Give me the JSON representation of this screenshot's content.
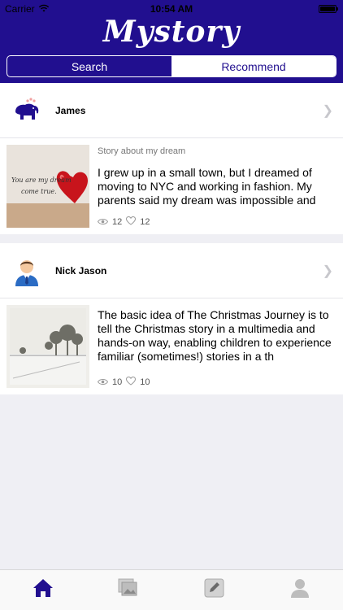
{
  "status_bar": {
    "carrier": "Carrier",
    "time": "10:54 AM"
  },
  "header": {
    "logo": "Mystory",
    "segments": [
      {
        "label": "Search",
        "selected": false
      },
      {
        "label": "Recommend",
        "selected": true
      }
    ]
  },
  "feed": [
    {
      "user": {
        "name": "James",
        "avatar": "elephant-icon"
      },
      "story": {
        "title": "Story about my dream",
        "text": "I grew up in a small town, but I dreamed of moving to NYC and working in fashion. My parents said my dream was impossible and",
        "views": "12",
        "likes": "12",
        "thumb_caption_1": "You are my dream",
        "thumb_caption_2": "come true."
      }
    },
    {
      "user": {
        "name": "Nick Jason",
        "avatar": "businessman-icon"
      },
      "story": {
        "title": "",
        "text": "The basic idea of The Christmas Journey is to tell the Christmas story in a multimedia and hands-on way, enabling children to experience familiar (sometimes!) stories in a th",
        "views": "10",
        "likes": "10"
      }
    }
  ],
  "tabbar": {
    "items": [
      {
        "name": "home-icon",
        "active": true
      },
      {
        "name": "gallery-icon",
        "active": false
      },
      {
        "name": "edit-icon",
        "active": false
      },
      {
        "name": "profile-icon",
        "active": false
      }
    ]
  },
  "colors": {
    "brand": "#210f8f",
    "background": "#efeff4"
  }
}
